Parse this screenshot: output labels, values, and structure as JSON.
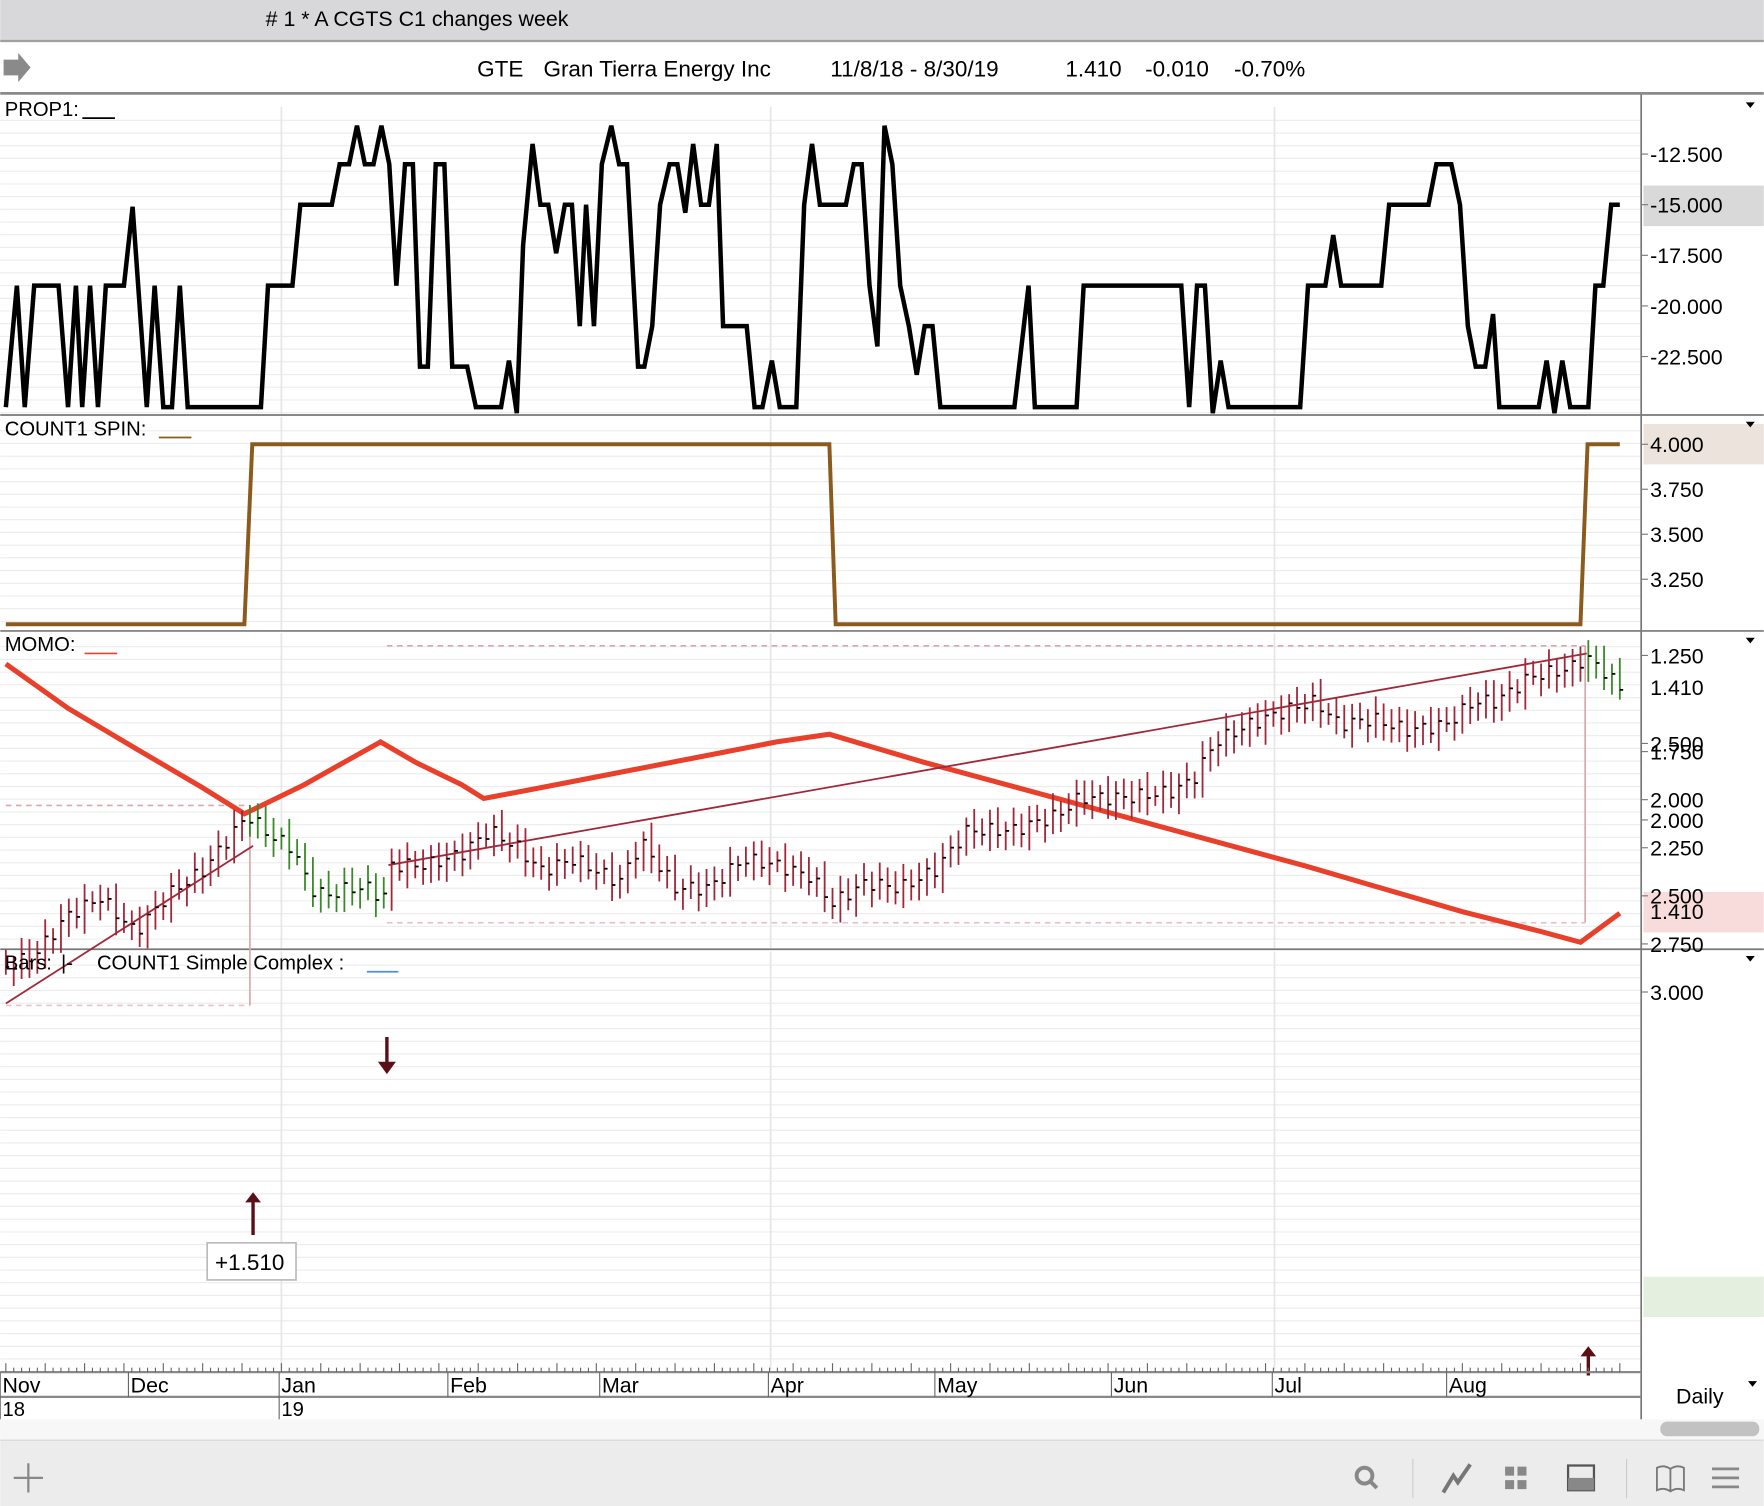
{
  "window": {
    "title": "# 1 * A CGTS  C1 changes week"
  },
  "header": {
    "symbol": "GTE",
    "company": "Gran Tierra Energy Inc",
    "range": "11/8/18 - 8/30/19",
    "last": "1.410",
    "change": "-0.010",
    "change_pct": "-0.70%"
  },
  "panels": {
    "prop1": {
      "label": "PROP1:",
      "ticks": [
        "-12.500",
        "-15.000",
        "-17.500",
        "-20.000",
        "-22.500"
      ],
      "highlight": "-15.000"
    },
    "spin": {
      "label": "COUNT1 SPIN:",
      "ticks": [
        "4.000",
        "3.750",
        "3.500",
        "3.250"
      ],
      "highlight": "4.000"
    },
    "momo": {
      "label": "MOMO:",
      "ticks": [
        "2.500",
        "2.000"
      ],
      "highlight": "1.410"
    },
    "bars": {
      "label": "Bars:",
      "legend_glyph": "|-",
      "study_label": "COUNT1 Simple Complex :",
      "ticks": [
        "3.000",
        "2.750",
        "2.500",
        "2.250",
        "2.000",
        "1.750",
        "1.250"
      ],
      "highlight": "1.410",
      "annotation": "+1.510"
    }
  },
  "x_axis": {
    "months": [
      "Nov",
      "Dec",
      "Jan",
      "Feb",
      "Mar",
      "Apr",
      "May",
      "Jun",
      "Jul",
      "Aug"
    ],
    "years": [
      "18",
      "19"
    ],
    "period": "Daily"
  },
  "toolbar": {
    "icons": [
      "add-icon",
      "search-icon",
      "line-chart-icon",
      "grid-icon",
      "panel-icon",
      "book-icon",
      "list-icon"
    ]
  },
  "colors": {
    "prop1": "#000000",
    "spin": "#8b5a1e",
    "momo": "#e8402a",
    "bars_down": "#a0283a",
    "bars_up": "#3a8a2a",
    "regression": "#a0283a",
    "box_fill": "#f6e6e6",
    "arrow": "#5a0f17"
  },
  "chart_data": [
    {
      "type": "line",
      "title": "PROP1",
      "ylim": [
        -25.5,
        -11
      ],
      "x_unit": "trading day",
      "xlim": [
        0,
        205
      ],
      "points": [
        [
          0,
          -25
        ],
        [
          1.4,
          -19
        ],
        [
          2.4,
          -25
        ],
        [
          3.6,
          -19
        ],
        [
          6.7,
          -19
        ],
        [
          7.9,
          -25
        ],
        [
          8.9,
          -19
        ],
        [
          9.7,
          -25
        ],
        [
          10.7,
          -19
        ],
        [
          11.7,
          -25
        ],
        [
          12.7,
          -19
        ],
        [
          15,
          -19
        ],
        [
          16.1,
          -15.1
        ],
        [
          17.9,
          -25
        ],
        [
          18.9,
          -19
        ],
        [
          20,
          -25
        ],
        [
          21.1,
          -25
        ],
        [
          22.1,
          -19
        ],
        [
          23.1,
          -25
        ],
        [
          32.4,
          -25
        ],
        [
          33.3,
          -19
        ],
        [
          36.4,
          -19
        ],
        [
          37.4,
          -15
        ],
        [
          41.4,
          -15
        ],
        [
          42.4,
          -13
        ],
        [
          43.6,
          -13
        ],
        [
          44.6,
          -11.1
        ],
        [
          45.6,
          -13
        ],
        [
          46.7,
          -13
        ],
        [
          47.7,
          -11.1
        ],
        [
          48.7,
          -13
        ],
        [
          49.6,
          -19
        ],
        [
          50.7,
          -13
        ],
        [
          51.7,
          -13
        ],
        [
          52.6,
          -23
        ],
        [
          53.6,
          -23
        ],
        [
          54.6,
          -13
        ],
        [
          55.7,
          -13
        ],
        [
          56.7,
          -23
        ],
        [
          58.6,
          -23
        ],
        [
          59.7,
          -25
        ],
        [
          62.9,
          -25
        ],
        [
          63.9,
          -22.7
        ],
        [
          64.9,
          -25.3
        ],
        [
          65.7,
          -17
        ],
        [
          66.9,
          -12
        ],
        [
          67.9,
          -15
        ],
        [
          68.9,
          -15
        ],
        [
          69.9,
          -17.4
        ],
        [
          71,
          -15
        ],
        [
          71.9,
          -15
        ],
        [
          72.9,
          -21
        ],
        [
          73.7,
          -15
        ],
        [
          74.7,
          -21
        ],
        [
          75.7,
          -13
        ],
        [
          76.9,
          -11.1
        ],
        [
          77.9,
          -13
        ],
        [
          78.9,
          -13
        ],
        [
          80.3,
          -23
        ],
        [
          81.1,
          -23
        ],
        [
          82.1,
          -21
        ],
        [
          83.1,
          -15
        ],
        [
          84.3,
          -13
        ],
        [
          85.3,
          -13
        ],
        [
          86.3,
          -15.4
        ],
        [
          87.3,
          -12
        ],
        [
          88.3,
          -15
        ],
        [
          89.3,
          -15
        ],
        [
          90.3,
          -12
        ],
        [
          91.1,
          -21
        ],
        [
          94.1,
          -21
        ],
        [
          95.1,
          -25
        ],
        [
          96.1,
          -25
        ],
        [
          97.3,
          -22.7
        ],
        [
          98.3,
          -25
        ],
        [
          100.4,
          -25
        ],
        [
          101.4,
          -15
        ],
        [
          102.4,
          -12
        ],
        [
          103.4,
          -15
        ],
        [
          106.7,
          -15
        ],
        [
          107.7,
          -13
        ],
        [
          108.7,
          -13
        ],
        [
          109.7,
          -19
        ],
        [
          110.7,
          -22
        ],
        [
          111.6,
          -11.1
        ],
        [
          112.6,
          -13
        ],
        [
          113.6,
          -19
        ],
        [
          114.7,
          -21
        ],
        [
          115.7,
          -23.4
        ],
        [
          116.7,
          -21
        ],
        [
          117.7,
          -21
        ],
        [
          118.7,
          -25
        ],
        [
          128.1,
          -25
        ],
        [
          129.9,
          -19
        ],
        [
          130.7,
          -25
        ],
        [
          136,
          -25
        ],
        [
          136.9,
          -19
        ],
        [
          149.3,
          -19
        ],
        [
          150.3,
          -25
        ],
        [
          151.3,
          -19
        ],
        [
          152.3,
          -19
        ],
        [
          153.3,
          -25.3
        ],
        [
          154.3,
          -22.7
        ],
        [
          155.3,
          -25
        ],
        [
          164.4,
          -25
        ],
        [
          165.4,
          -19
        ],
        [
          167.6,
          -19
        ],
        [
          168.6,
          -16.5
        ],
        [
          169.6,
          -19
        ],
        [
          174.7,
          -19
        ],
        [
          175.7,
          -15
        ],
        [
          180.7,
          -15
        ],
        [
          181.7,
          -13
        ],
        [
          183.6,
          -13
        ],
        [
          184.7,
          -15
        ],
        [
          185.7,
          -21
        ],
        [
          186.7,
          -23
        ],
        [
          187.9,
          -23
        ],
        [
          188.9,
          -20.4
        ],
        [
          189.7,
          -25
        ],
        [
          194.7,
          -25
        ],
        [
          195.7,
          -22.7
        ],
        [
          196.7,
          -25.3
        ],
        [
          197.7,
          -22.7
        ],
        [
          198.7,
          -25
        ],
        [
          201,
          -25
        ],
        [
          201.9,
          -19
        ],
        [
          202.9,
          -19
        ],
        [
          203.9,
          -15
        ],
        [
          205,
          -15
        ]
      ]
    },
    {
      "type": "line",
      "title": "COUNT1 SPIN",
      "ylim": [
        2.95,
        4.1
      ],
      "xlim": [
        0,
        205
      ],
      "points": [
        [
          0,
          3
        ],
        [
          30.3,
          3
        ],
        [
          31.3,
          4
        ],
        [
          104.6,
          4
        ],
        [
          105.4,
          3
        ],
        [
          200,
          3
        ],
        [
          200.9,
          4
        ],
        [
          205,
          4
        ]
      ]
    },
    {
      "type": "line",
      "title": "MOMO",
      "ylim": [
        1.15,
        3.05
      ],
      "xlim": [
        0,
        205
      ],
      "points": [
        [
          0,
          3.02
        ],
        [
          7.9,
          2.73
        ],
        [
          16.4,
          2.47
        ],
        [
          25,
          2.21
        ],
        [
          30.3,
          2.04
        ],
        [
          37.9,
          2.23
        ],
        [
          42.9,
          2.375
        ],
        [
          47.6,
          2.51
        ],
        [
          52.1,
          2.375
        ],
        [
          57.9,
          2.23
        ],
        [
          60.7,
          2.14
        ],
        [
          67.9,
          2.21
        ],
        [
          77.9,
          2.31
        ],
        [
          87.9,
          2.41
        ],
        [
          97.9,
          2.51
        ],
        [
          104.6,
          2.56
        ],
        [
          116.4,
          2.38
        ],
        [
          125,
          2.26
        ],
        [
          135,
          2.12
        ],
        [
          145.7,
          1.97
        ],
        [
          156.4,
          1.82
        ],
        [
          165,
          1.7
        ],
        [
          175,
          1.55
        ],
        [
          185,
          1.4
        ],
        [
          195,
          1.27
        ],
        [
          200,
          1.2
        ],
        [
          205,
          1.39
        ]
      ]
    },
    {
      "type": "bar-ohlc",
      "title": "GTE Daily",
      "ylim": [
        1.1,
        3.05
      ],
      "xlim": [
        0,
        205
      ],
      "close_path": [
        [
          0,
          2.87
        ],
        [
          3.6,
          2.81
        ],
        [
          7.9,
          2.6
        ],
        [
          12,
          2.51
        ],
        [
          16.4,
          2.69
        ],
        [
          20.7,
          2.49
        ],
        [
          25,
          2.37
        ],
        [
          27.9,
          2.22
        ],
        [
          30.7,
          2.08
        ],
        [
          33.6,
          2.19
        ],
        [
          36.4,
          2.25
        ],
        [
          38.6,
          2.46
        ],
        [
          40.7,
          2.5
        ],
        [
          43.6,
          2.46
        ],
        [
          46.4,
          2.46
        ],
        [
          47.9,
          2.53
        ],
        [
          48.6,
          2.34
        ],
        [
          53.6,
          2.34
        ],
        [
          57.9,
          2.28
        ],
        [
          61.4,
          2.16
        ],
        [
          65,
          2.25
        ],
        [
          67.9,
          2.37
        ],
        [
          72.1,
          2.31
        ],
        [
          77.9,
          2.43
        ],
        [
          80.7,
          2.22
        ],
        [
          85,
          2.46
        ],
        [
          89.3,
          2.46
        ],
        [
          93.6,
          2.31
        ],
        [
          97.9,
          2.34
        ],
        [
          102.1,
          2.4
        ],
        [
          105,
          2.54
        ],
        [
          109.3,
          2.43
        ],
        [
          113.6,
          2.46
        ],
        [
          117.9,
          2.37
        ],
        [
          122.1,
          2.16
        ],
        [
          127.9,
          2.16
        ],
        [
          133.6,
          2.08
        ],
        [
          136.4,
          1.99
        ],
        [
          142.1,
          1.99
        ],
        [
          147.9,
          1.96
        ],
        [
          150.7,
          1.9
        ],
        [
          153.6,
          1.7
        ],
        [
          157.9,
          1.61
        ],
        [
          163.6,
          1.52
        ],
        [
          166.4,
          1.49
        ],
        [
          169.3,
          1.61
        ],
        [
          173.6,
          1.58
        ],
        [
          177.9,
          1.64
        ],
        [
          182.9,
          1.61
        ],
        [
          186.4,
          1.49
        ],
        [
          189.3,
          1.49
        ],
        [
          193.6,
          1.36
        ],
        [
          198.6,
          1.32
        ],
        [
          200.7,
          1.26
        ],
        [
          202.9,
          1.33
        ],
        [
          205,
          1.42
        ]
      ],
      "up_ranges": [
        [
          31,
          48
        ],
        [
          201,
          205
        ]
      ],
      "boxes": [
        {
          "x": [
            0,
            31
          ],
          "y": [
            2.03,
            3.07
          ]
        },
        {
          "x": [
            48.4,
            200.6
          ],
          "y": [
            1.2,
            2.64
          ]
        }
      ],
      "regressions": [
        {
          "from": [
            0,
            3.06
          ],
          "to": [
            31.4,
            2.24
          ]
        },
        {
          "from": [
            48.6,
            2.34
          ],
          "to": [
            200.8,
            1.24
          ]
        }
      ],
      "arrows": [
        {
          "day": 31.4,
          "dir": "up"
        },
        {
          "day": 48.4,
          "dir": "down"
        },
        {
          "day": 201,
          "dir": "up"
        }
      ]
    }
  ]
}
